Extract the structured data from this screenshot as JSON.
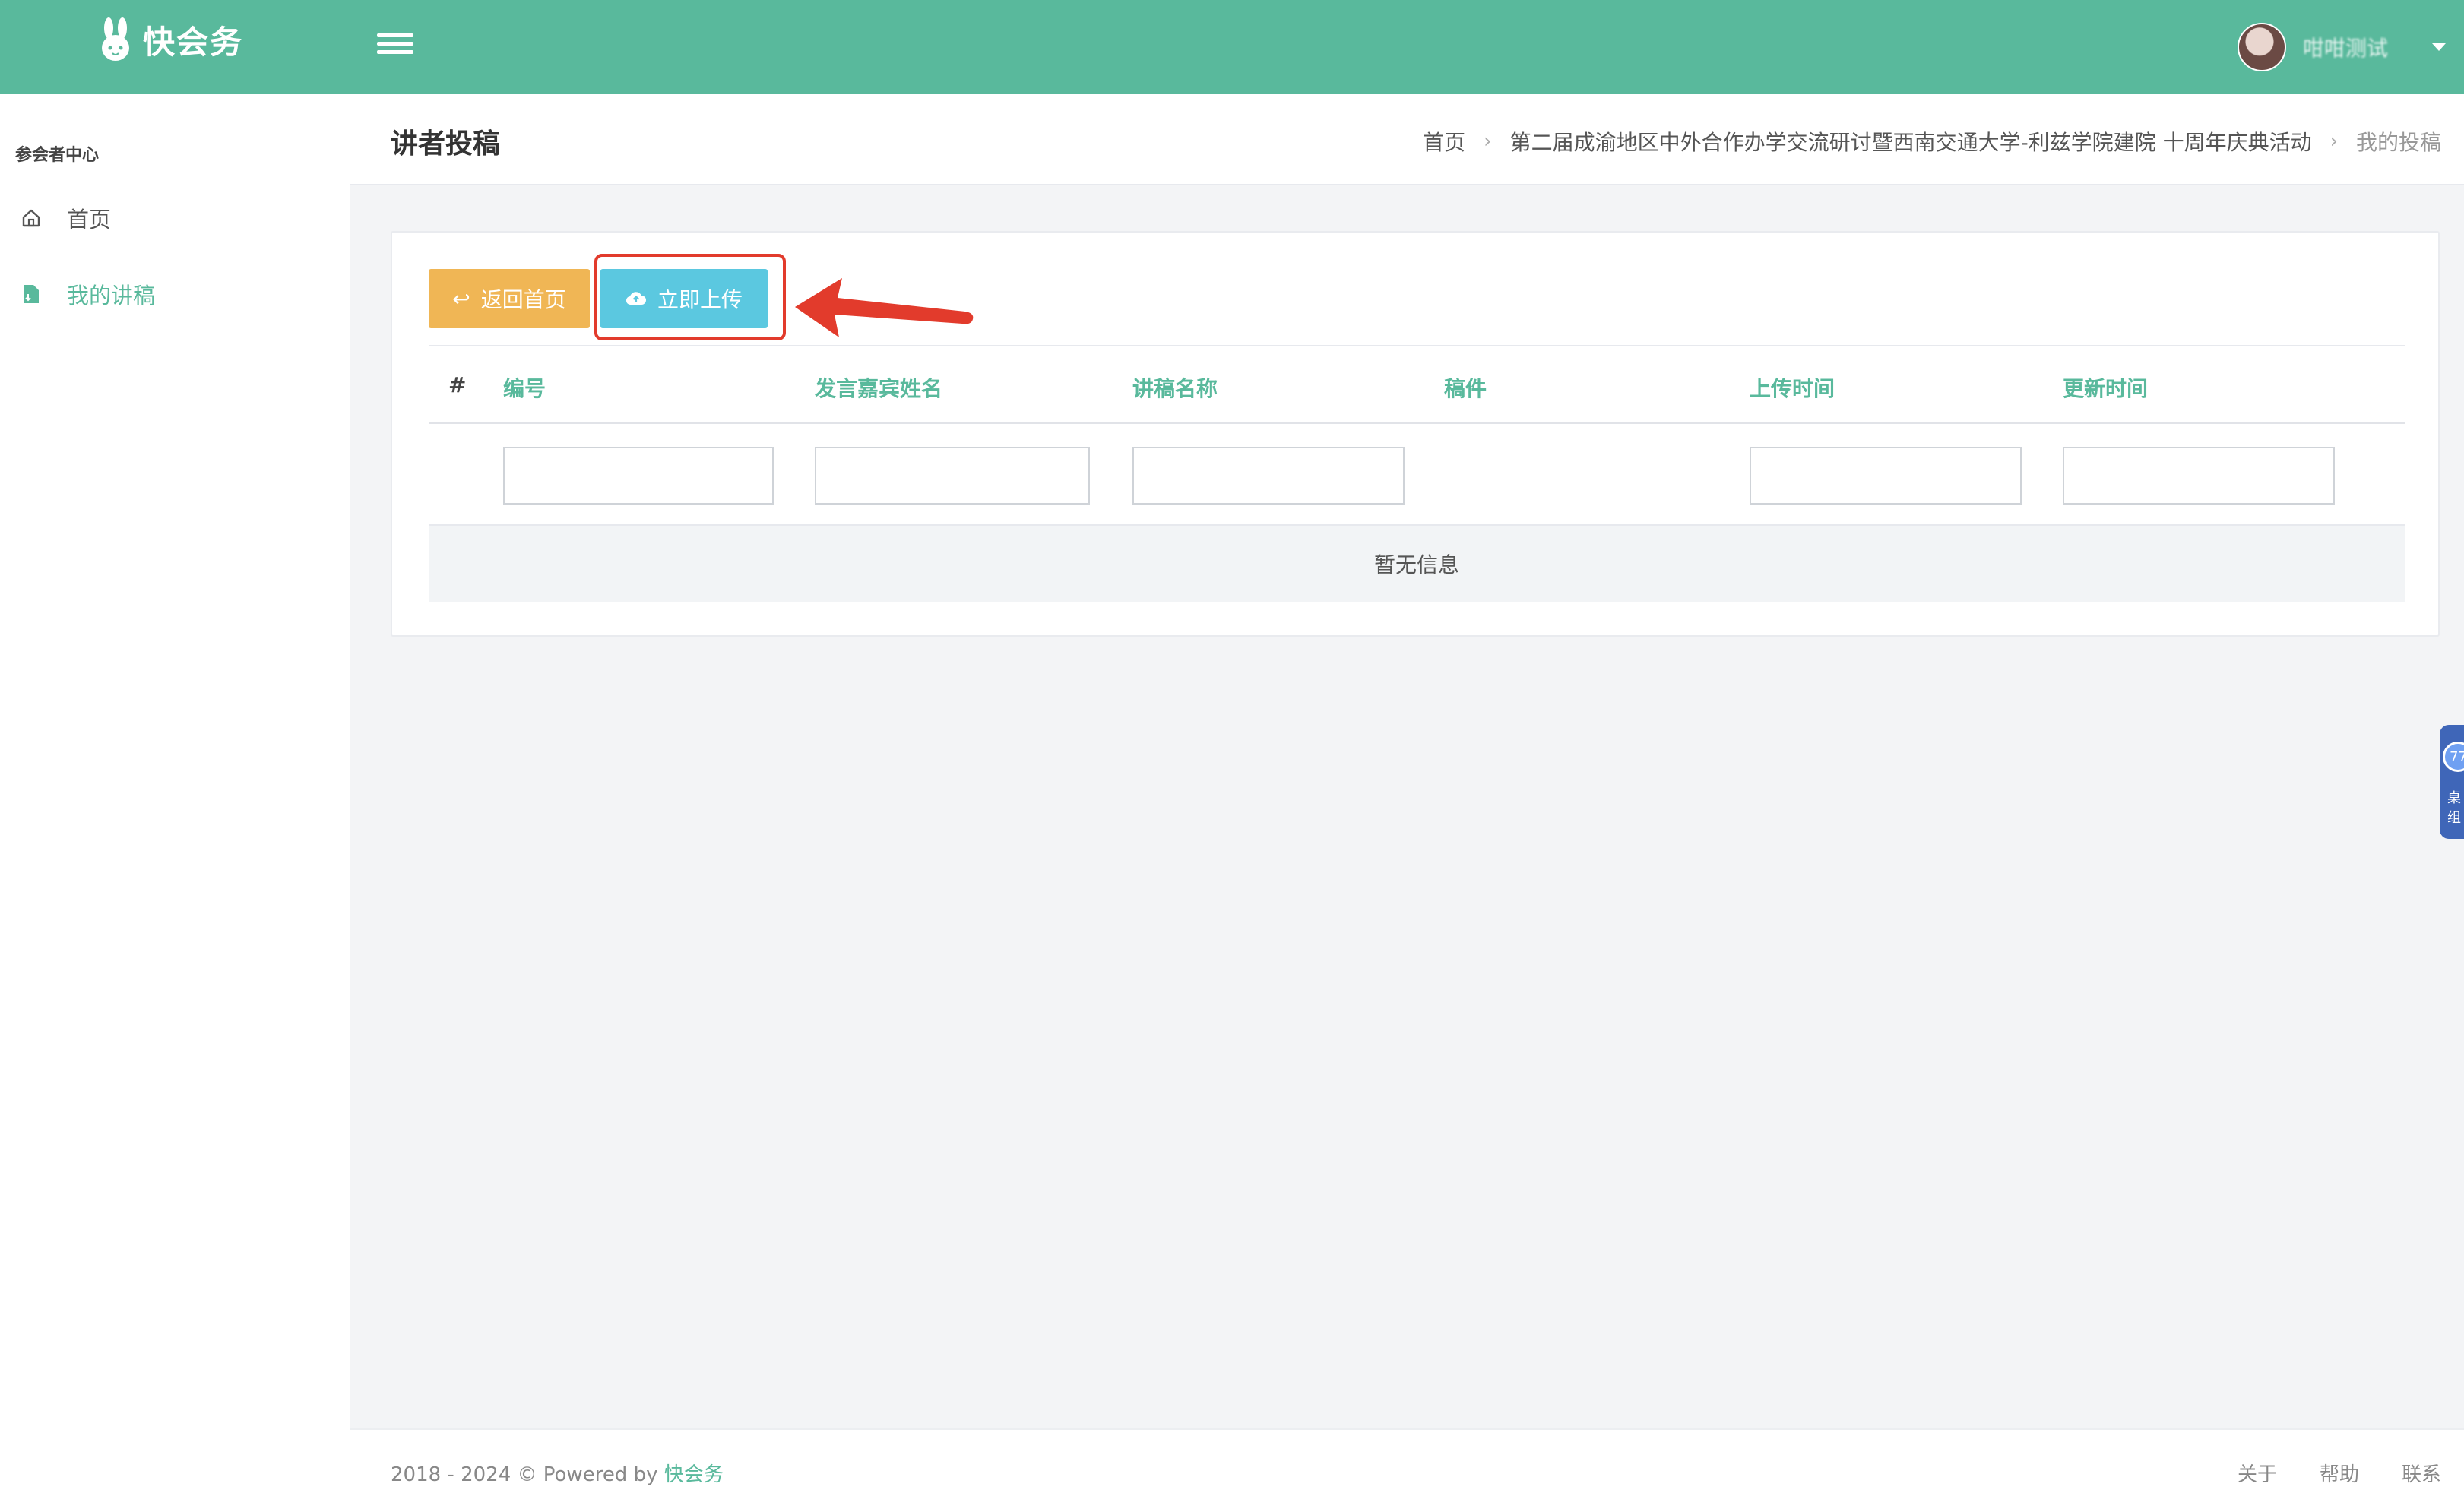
{
  "app": {
    "name": "快会务"
  },
  "header": {
    "user_name": "咁咁测试"
  },
  "sidebar": {
    "heading": "参会者中心",
    "items": [
      {
        "label": "首页",
        "icon": "home-icon",
        "active": false
      },
      {
        "label": "我的讲稿",
        "icon": "document-icon",
        "active": true
      }
    ]
  },
  "page": {
    "title": "讲者投稿",
    "breadcrumb": [
      "首页",
      "第二届成渝地区中外合作办学交流研讨暨西南交通大学-利兹学院建院 十周年庆典活动",
      "我的投稿"
    ]
  },
  "toolbar": {
    "back_label": "返回首页",
    "upload_label": "立即上传"
  },
  "table": {
    "columns": [
      "#",
      "编号",
      "发言嘉宾姓名",
      "讲稿名称",
      "稿件",
      "上传时间",
      "更新时间"
    ],
    "empty_text": "暂无信息"
  },
  "footer": {
    "copyright_prefix": "2018 - 2024 © Powered by",
    "copyright_brand": "快会务",
    "links": [
      "关于",
      "帮助",
      "联系"
    ]
  },
  "float_widget": {
    "badge": "77",
    "text": "桌组"
  },
  "colors": {
    "primary": "#59b99c",
    "warning": "#f0b655",
    "info": "#5bc8e0",
    "annotation": "#e23b2c"
  }
}
